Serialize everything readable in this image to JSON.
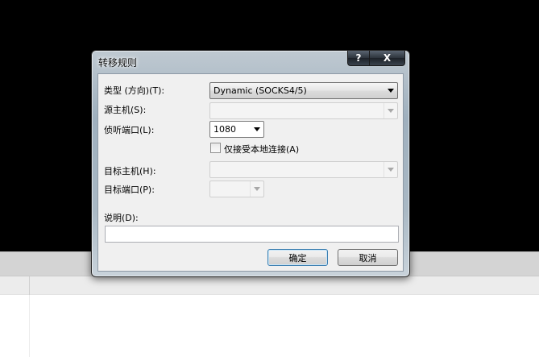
{
  "dialog": {
    "title": "转移规则",
    "help_glyph": "?",
    "close_glyph": "X"
  },
  "form": {
    "type_label": "类型 (方向)(T):",
    "type_value": "Dynamic (SOCKS4/5)",
    "source_host_label": "源主机(S):",
    "source_host_value": "",
    "listen_port_label": "侦听端口(L):",
    "listen_port_value": "1080",
    "local_only_label": "仅接受本地连接(A)",
    "local_only_checked": false,
    "target_host_label": "目标主机(H):",
    "target_host_value": "",
    "target_port_label": "目标端口(P):",
    "target_port_value": "",
    "description_label": "说明(D):",
    "description_value": ""
  },
  "buttons": {
    "ok_label": "确定",
    "cancel_label": "取消"
  },
  "colors": {
    "backdrop": "#000000",
    "dialog_face": "#f0f0f0",
    "default_button_border": "#3c7fb1"
  }
}
